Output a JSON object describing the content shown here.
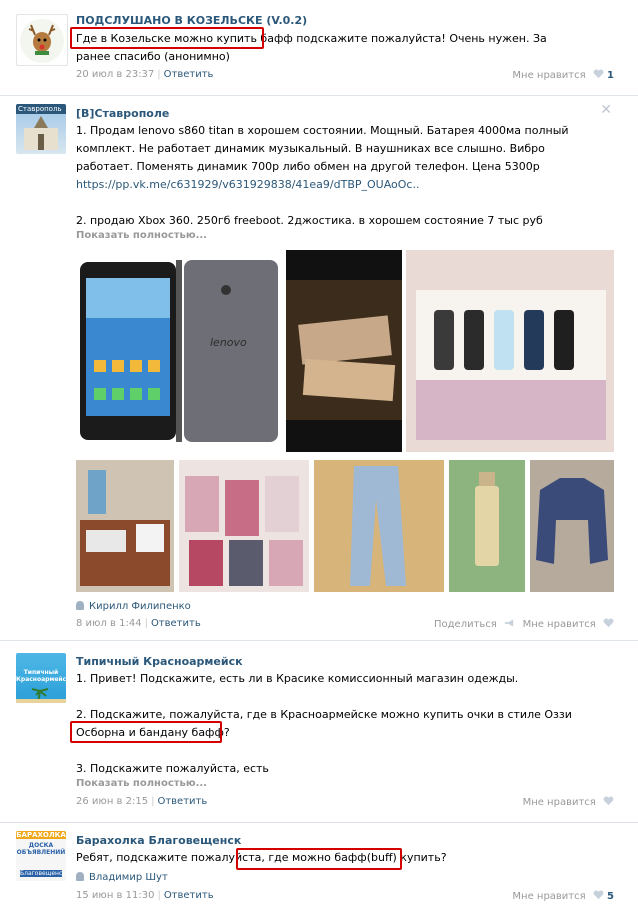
{
  "posts": [
    {
      "title": "ПОДСЛУШАНО В КОЗЕЛЬСКЕ (V.0.2)",
      "text_highlight": "Где в Козельске можно купить бафф",
      "text_rest": " подскажите пожалуйста! Очень нужен. За",
      "text_line2": "ранее спасибо (анонимно)",
      "date": "20 июл в 23:37",
      "reply": "Ответить",
      "like_label": "Мне нравится",
      "like_count": "1"
    },
    {
      "title": "[В]Ставрополе",
      "avatar_caption": "Ставрополь",
      "lines": [
        "1. Продам lenovo s860 titan в хорошем состоянии. Мощный. Батарея 4000ма полный",
        "комплект. Не работает динамик музыкальный. В наушниках все слышно. Вибро",
        "работает. Поменять динамик 700р либо обмен на другой телефон. Цена 5300р"
      ],
      "url": "https://pp.vk.me/c631929/v631929838/41ea9/dTBP_OUAoOc..",
      "line_item2": "2. продаю Xbox 360. 250гб freeboot. 2джостика. в хорошем состояние 7 тыс руб",
      "show_more": "Показать полностью...",
      "phone_brand": "lenovo",
      "author": "Кирилл Филипенко",
      "date": "8 июл в 1:44",
      "reply": "Ответить",
      "share_label": "Поделиться",
      "like_label": "Мне нравится"
    },
    {
      "title": "Типичный Красноармейск",
      "avatar_caption": "Типичный Красноармейск",
      "line1": "1. Привет! Подскажите, есть ли в Красике комиссионный магазин одежды.",
      "line2": "2. Подскажите, пожалуйста, где в Красноармейске можно купить очки в стиле Оззи",
      "line2_highlight": "Осборна и бандану бафф?",
      "line3": "3. Подскажите пожалуйста, есть",
      "show_more": "Показать полностью...",
      "date": "26 июн в 2:15",
      "reply": "Ответить",
      "like_label": "Мне нравится"
    },
    {
      "title": "Барахолка Благовещенск",
      "avatar_caption1": "БАРАХОЛКА",
      "avatar_caption2": "ДОСКА ОБЪЯВЛЕНИЙ",
      "avatar_caption3": "Благовещенск",
      "text_before": "Ребят, подскажите пожалуйста, ",
      "text_highlight": "где можно бафф(buff) купить?",
      "author": "Владимир Шут",
      "date": "15 июн в 11:30",
      "reply": "Ответить",
      "like_label": "Мне нравится",
      "like_count": "5"
    }
  ],
  "colors": {
    "link": "#2b587a",
    "muted": "#999999",
    "highlight_border": "#d40000"
  }
}
